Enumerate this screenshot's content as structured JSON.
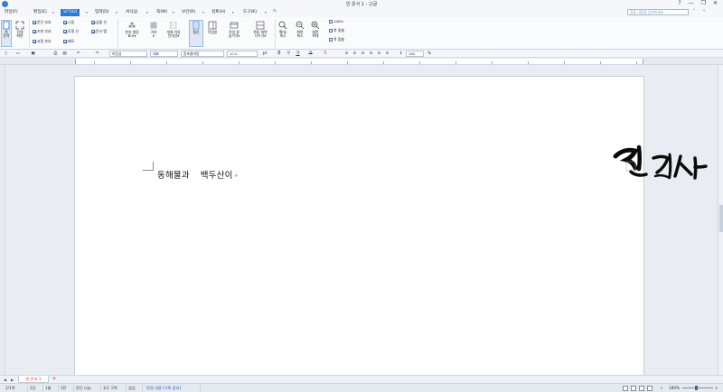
{
  "window": {
    "title": "빈 문서 1 - 근글",
    "controls": [
      "?",
      "—",
      "❐",
      "✕"
    ]
  },
  "menus": [
    {
      "label": "파일(F)"
    },
    {
      "label": "편집(E)"
    },
    {
      "label": "보기(U)",
      "active": true
    },
    {
      "label": "입력(D)"
    },
    {
      "label": "서식(J)"
    },
    {
      "label": "쪽(W)"
    },
    {
      "label": "보안(R)"
    },
    {
      "label": "검토(H)"
    },
    {
      "label": "도구(K)"
    }
  ],
  "menubar_search_placeholder": "찾을 내용을 입력하세요",
  "ribbon": {
    "page_zoom_label": "쪽\n윤곽",
    "full_screen_label": "전체\n화면",
    "checks_col1": [
      {
        "label": "문단 부호",
        "checked": true
      },
      {
        "label": "조판 부호",
        "checked": true
      },
      {
        "label": "교정 부호",
        "checked": true
      }
    ],
    "checks_col2": [
      {
        "label": "그림",
        "checked": true
      },
      {
        "label": "투명 선",
        "checked": true
      },
      {
        "label": "메모",
        "checked": true
      }
    ],
    "checks_col3": [
      {
        "label": "상황 선",
        "checked": true
      },
      {
        "label": "문서 탭",
        "checked": true
      }
    ],
    "hanja_label": "한자 발음\n표시▾",
    "grid_label": "격자\n▾",
    "view_grid_label": "개체 이동\n안내선▾",
    "ruler_label": "탭선",
    "sidebar_label": "작업창",
    "task_label": "작업 창\n숨기기▾",
    "edit_screen_label": "편집 화면\n나누기▾",
    "zoom_label": "확대/\n축소",
    "zoom_out_label": "화면\n축소",
    "zoom_in_label": "화면\n확대",
    "zoom_options": [
      "100%",
      "쪽 맞춤",
      "폭 맞춤"
    ]
  },
  "formatbar": {
    "style": "바탕글",
    "language": "대표",
    "font": "함초롬바탕",
    "size": "10.0",
    "size_unit": "pt",
    "line_spacing": "160",
    "line_spacing_unit": "%",
    "bold": "가",
    "italic": "가",
    "underline": "가",
    "strike": "가"
  },
  "document": {
    "text_part1": "동해물과",
    "text_part2": "백두산이",
    "paragraph_mark": "↲",
    "signature_text": "진경사"
  },
  "tabs": {
    "doc_tab": "빈 문서 1",
    "add": "+"
  },
  "status": {
    "page": "1/1쪽",
    "section": "1단",
    "line": "1줄",
    "column": "1칸",
    "paragraph_split": "문단 나눔",
    "sections": "1/1 구역",
    "insert": "삽입",
    "change_tracking": "변경 내용 [기록 중지]",
    "zoom": "180%"
  },
  "colors": {
    "accent": "#2b7bd5",
    "tab_red": "#c0392b",
    "page_bg": "#ffffff",
    "workspace_bg": "#e9edf3"
  }
}
